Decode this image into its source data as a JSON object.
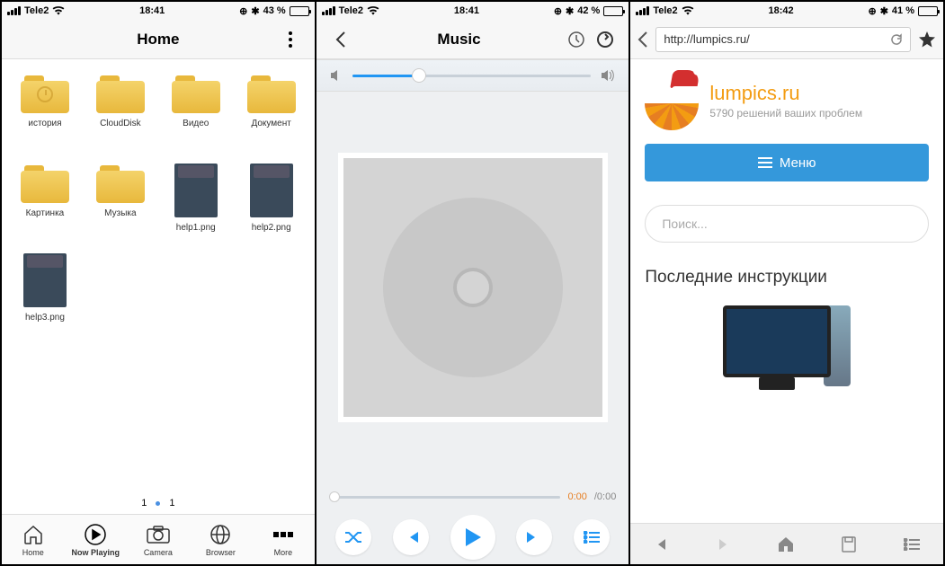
{
  "phone1": {
    "status": {
      "carrier": "Tele2",
      "time": "18:41",
      "battery_pct": "43 %",
      "battery_fill": 43
    },
    "nav": {
      "title": "Home"
    },
    "items": [
      {
        "type": "folder-history",
        "label": "история"
      },
      {
        "type": "folder",
        "label": "CloudDisk"
      },
      {
        "type": "folder",
        "label": "Видео"
      },
      {
        "type": "folder",
        "label": "Документ"
      },
      {
        "type": "folder",
        "label": "Картинка"
      },
      {
        "type": "folder",
        "label": "Музыка"
      },
      {
        "type": "image",
        "label": "help1.png"
      },
      {
        "type": "image",
        "label": "help2.png"
      },
      {
        "type": "image",
        "label": "help3.png"
      }
    ],
    "pager": {
      "current": "1",
      "total": "1"
    },
    "tabs": [
      {
        "label": "Home",
        "icon": "home"
      },
      {
        "label": "Now Playing",
        "icon": "play",
        "active": true
      },
      {
        "label": "Camera",
        "icon": "camera"
      },
      {
        "label": "Browser",
        "icon": "globe"
      },
      {
        "label": "More",
        "icon": "more"
      }
    ]
  },
  "phone2": {
    "status": {
      "carrier": "Tele2",
      "time": "18:41",
      "battery_pct": "42 %",
      "battery_fill": 42
    },
    "nav": {
      "title": "Music"
    },
    "time": {
      "current": "0:00",
      "total": "/0:00"
    }
  },
  "phone3": {
    "status": {
      "carrier": "Tele2",
      "time": "18:42",
      "battery_pct": "41 %",
      "battery_fill": 41
    },
    "url": "http://lumpics.ru/",
    "site": {
      "name": "lumpics.ru",
      "tagline": "5790 решений ваших проблем"
    },
    "menu_label": "Меню",
    "search_placeholder": "Поиск...",
    "section_heading": "Последние инструкции"
  }
}
